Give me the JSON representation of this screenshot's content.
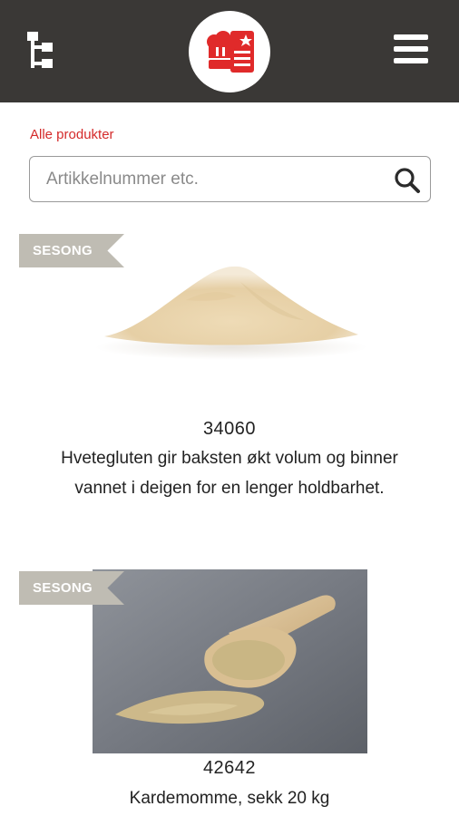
{
  "header": {
    "tree_icon": "category-tree-icon",
    "logo_icon": "chef-hat-logo-icon",
    "menu_icon": "hamburger-menu-icon"
  },
  "breadcrumb": "Alle produkter",
  "search": {
    "placeholder": "Artikkelnummer etc.",
    "value": "",
    "icon": "search-icon"
  },
  "products": [
    {
      "badge": "SESONG",
      "number": "34060",
      "description": "Hvetegluten gir baksten økt volum og binner vannet i deigen for en lenger holdbarhet.",
      "image": "flour-pile-image"
    },
    {
      "badge": "SESONG",
      "number": "42642",
      "description": "Kardemomme, sekk 20 kg",
      "image": "wooden-scoop-spice-image"
    }
  ],
  "colors": {
    "header_bg": "#3a3836",
    "accent": "#d42a2a",
    "badge_bg": "#bfbcb3"
  }
}
